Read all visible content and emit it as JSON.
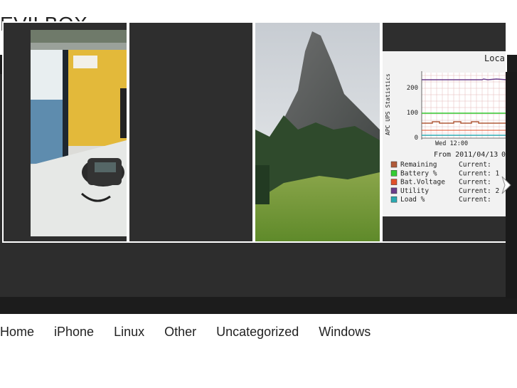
{
  "site": {
    "title": "EVILBOX"
  },
  "nav": {
    "items": [
      {
        "label": "Home"
      },
      {
        "label": "iPhone"
      },
      {
        "label": "Linux"
      },
      {
        "label": "Other"
      },
      {
        "label": "Uncategorized"
      },
      {
        "label": "Windows"
      }
    ]
  },
  "slider": {
    "ups_chart": {
      "title_fragment": "Loca",
      "ylabel": "APC UPS Statistics",
      "yticks": [
        "200",
        "100",
        "0"
      ],
      "xtick": "Wed 12:00",
      "from_text": "From 2011/04/13",
      "from_suffix": "0",
      "legend": [
        {
          "label": "Remaining",
          "current": "Current:",
          "value": "",
          "color": "#b05a3a"
        },
        {
          "label": "Battery %",
          "current": "Current:",
          "value": "1",
          "color": "#33cc33"
        },
        {
          "label": "Bat.Voltage",
          "current": "Current:",
          "value": "",
          "color": "#e0502a"
        },
        {
          "label": "Utility",
          "current": "Current:",
          "value": "2",
          "color": "#6a3d8a"
        },
        {
          "label": "Load %",
          "current": "Current:",
          "value": "",
          "color": "#2aa8b0"
        }
      ]
    }
  },
  "colors": {
    "bar_dark": "#1c1c1c",
    "slide_bg": "#2d2d2d",
    "text": "#222222"
  }
}
